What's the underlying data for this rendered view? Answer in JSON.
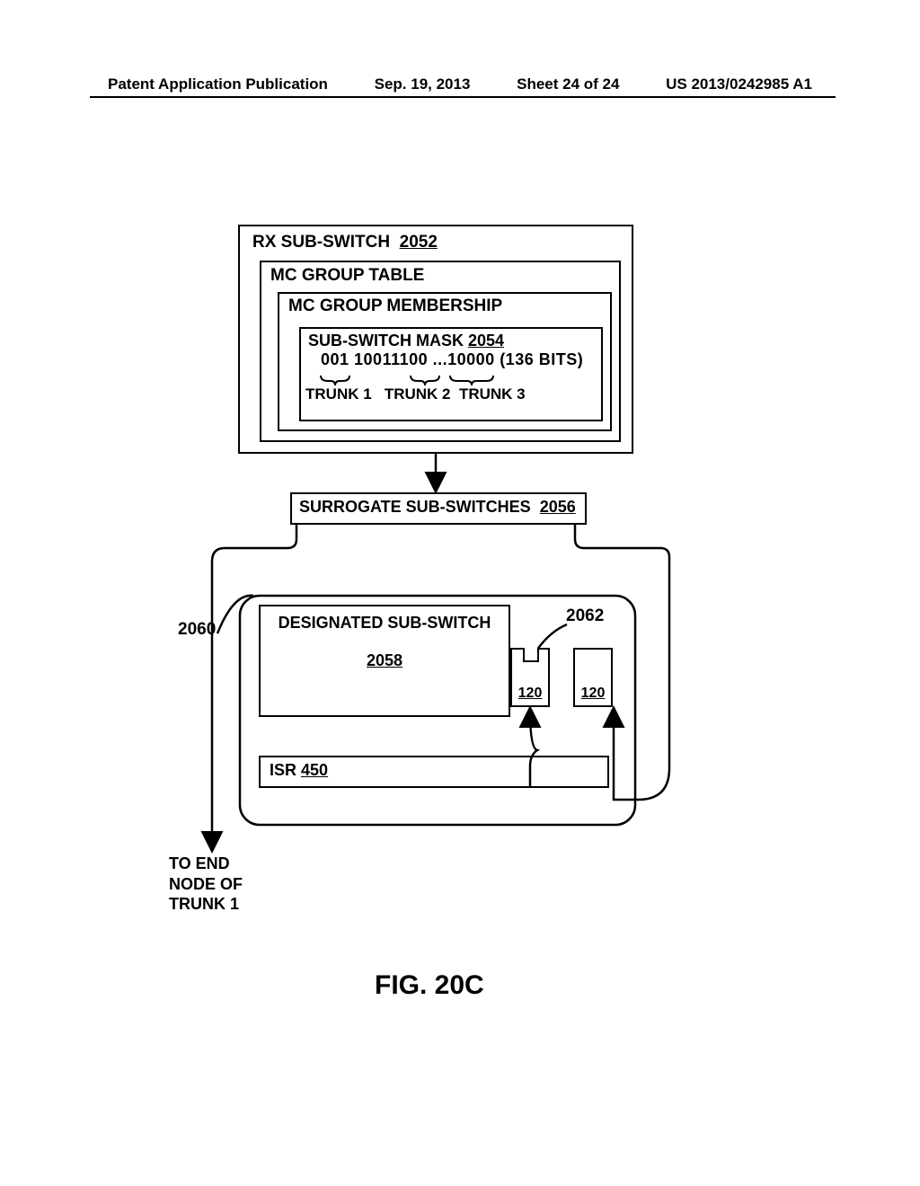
{
  "header": {
    "pub_type": "Patent Application Publication",
    "date": "Sep. 19, 2013",
    "sheet": "Sheet 24 of 24",
    "pub_num": "US 2013/0242985 A1"
  },
  "rx": {
    "title": "RX SUB-SWITCH",
    "ref": "2052",
    "mc_table": "MC GROUP TABLE",
    "mc_membership": "MC GROUP MEMBERSHIP",
    "mask_title": "SUB-SWITCH MASK",
    "mask_ref": "2054",
    "mask_bits": "001 10011100 ...10000 (136 BITS)",
    "trunk1": "TRUNK 1",
    "trunk2": "TRUNK 2",
    "trunk3": "TRUNK 3"
  },
  "surrogate": {
    "label": "SURROGATE SUB-SWITCHES",
    "ref": "2056"
  },
  "designated": {
    "label": "DESIGNATED SUB-SWITCH",
    "ref": "2058"
  },
  "port1": {
    "ref": "120"
  },
  "port2": {
    "ref": "120"
  },
  "isr": {
    "label": "ISR",
    "ref": "450"
  },
  "callouts": {
    "c2060": "2060",
    "c2062": "2062"
  },
  "end_node": {
    "line1": "TO END",
    "line2": "NODE OF",
    "line3": "TRUNK 1"
  },
  "figure": "FIG. 20C"
}
